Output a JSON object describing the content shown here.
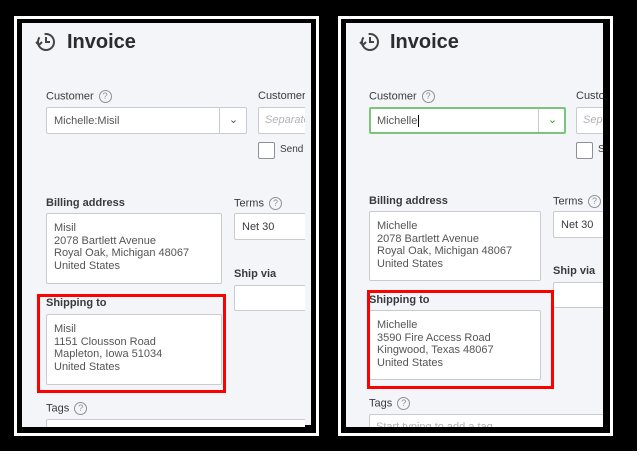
{
  "left": {
    "title": "Invoice",
    "customer_label": "Customer",
    "customer_value": "Michelle:Misil",
    "customer_email_label": "Customer",
    "customer_email_placeholder": "Separate",
    "send_label": "Send",
    "billing_label": "Billing address",
    "billing_address": "Misil\n2078 Bartlett Avenue\nRoyal Oak, Michigan  48067\nUnited States",
    "terms_label": "Terms",
    "terms_value": "Net 30",
    "ship_via_label": "Ship via",
    "shipping_label": "Shipping to",
    "shipping_address": "Misil\n1151 Clousson Road\nMapleton, Iowa  51034\nUnited States",
    "tags_label": "Tags"
  },
  "right": {
    "title": "Invoice",
    "customer_label": "Customer",
    "customer_value": "Michelle",
    "customer_email_label": "Custo",
    "customer_email_placeholder": "Sep",
    "send_label": "S",
    "billing_label": "Billing address",
    "billing_address": "Michelle\n2078 Bartlett Avenue\nRoyal Oak, Michigan  48067\nUnited States",
    "terms_label": "Terms",
    "terms_value": "Net 30",
    "ship_via_label": "Ship via",
    "shipping_label": "Shipping to",
    "shipping_address": "Michelle\n3590 Fire Access Road\nKingwood, Texas  48067\nUnited States",
    "tags_label": "Tags",
    "tags_placeholder": "Start typing to add a tag"
  },
  "help_glyph": "?",
  "colors": {
    "highlight": "#ff0000",
    "focus": "#2ca01c"
  }
}
